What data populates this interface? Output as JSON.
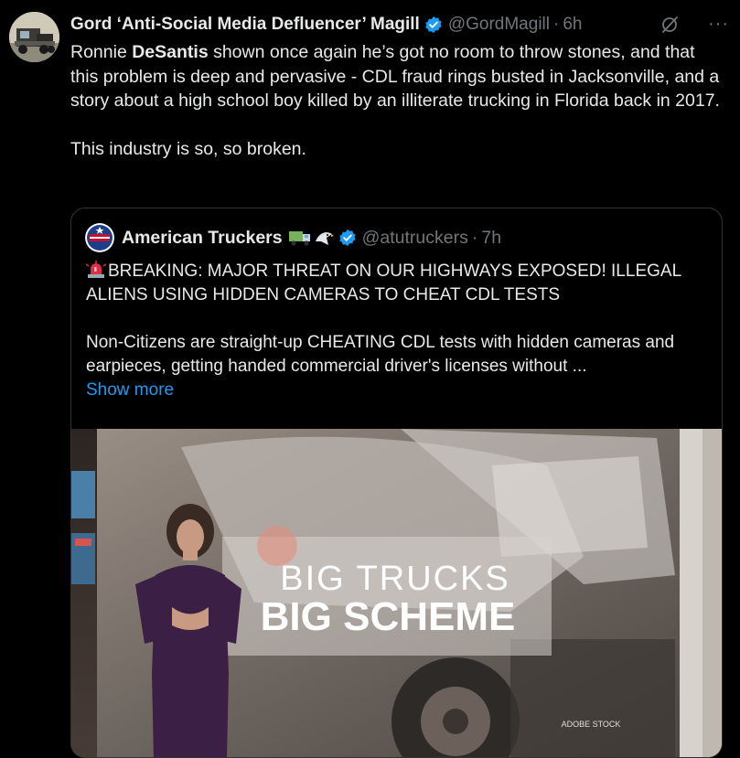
{
  "tweet": {
    "author_name": "Gord ‘Anti-Social Media Defluencer’ Magill",
    "handle": "@GordMagill",
    "time": "6h",
    "text_1_pre": "Ronnie ",
    "text_1_bold": "DeSantis",
    "text_1_post": " shown once again he’s got no room to throw stones, and that this problem is deep and pervasive - CDL fraud rings busted in Jacksonville, and a story about a high school boy killed by an illiterate trucking in Florida back in 2017.",
    "text_2": "This industry is so, so broken.",
    "more_glyph": "···"
  },
  "quote": {
    "author_name": "American Truckers",
    "emoji": [
      "truck",
      "eagle"
    ],
    "handle": "@atutruckers",
    "time": "7h",
    "headline": "BREAKING: MAJOR THREAT ON OUR HIGHWAYS EXPOSED! ILLEGAL ALIENS USING HIDDEN CAMERAS TO CHEAT CDL TESTS",
    "body": "Non-Citizens are straight-up CHEATING CDL tests with hidden cameras and earpieces, getting handed commercial driver's licenses without ...",
    "show_more": "Show more",
    "media": {
      "headline_line1": "BIG TRUCKS",
      "headline_line2": "BIG SCHEME",
      "credit": "ADOBE STOCK"
    }
  },
  "colors": {
    "background": "#000000",
    "text": "#e7e9ea",
    "muted": "#71767b",
    "link": "#1d9bf0",
    "verified": "#1d9bf0",
    "siren": "#e0245e"
  }
}
